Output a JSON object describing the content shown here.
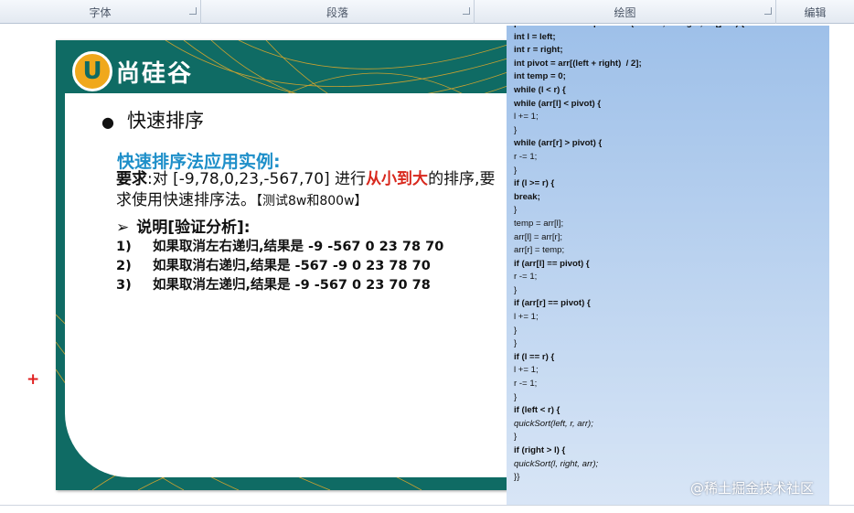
{
  "ribbon": {
    "groups": [
      "字体",
      "段落",
      "绘图",
      "编辑"
    ]
  },
  "slide": {
    "logo_letter": "U",
    "logo_text": "尚硅谷",
    "bullet_dot": "●",
    "title": "快速排序",
    "subheading": "快速排序法应用实例:",
    "req_label": "要求",
    "req_text1": ":对 [-9,78,0,23,-567,70] 进行",
    "req_red": "从小到大",
    "req_text2": "的排序,要求使用快速排序法。",
    "req_note": "【测试8w和800w】",
    "explain_arrow": "➢",
    "explain": "说明[验证分析]:",
    "items": [
      {
        "num": "1)",
        "text": "如果取消左右递归,结果是   -9 -567 0 23 78 70"
      },
      {
        "num": "2)",
        "text": "如果取消右递归,结果是 -567 -9 0 23 78 70"
      },
      {
        "num": "3)",
        "text": "如果取消左递归,结果是 -9 -567 0 23 70 78"
      }
    ]
  },
  "code_lines": [
    {
      "t": "public  static void quickSort(int  left, int right, int[] arr) {",
      "s": "b"
    },
    {
      "t": "int l = left;",
      "s": "b"
    },
    {
      "t": "int r = right;",
      "s": "b"
    },
    {
      "t": "int pivot = arr[(left + right)  / 2];",
      "s": "b"
    },
    {
      "t": "int temp = 0;",
      "s": "b"
    },
    {
      "t": "while (l < r) {",
      "s": "b"
    },
    {
      "t": "while (arr[l] < pivot) {",
      "s": "b"
    },
    {
      "t": "l += 1;",
      "s": ""
    },
    {
      "t": "}",
      "s": ""
    },
    {
      "t": "while (arr[r] > pivot) {",
      "s": "b"
    },
    {
      "t": "r -= 1;",
      "s": ""
    },
    {
      "t": "}",
      "s": ""
    },
    {
      "t": "if (l >= r) {",
      "s": "b"
    },
    {
      "t": "break;",
      "s": "b"
    },
    {
      "t": "}",
      "s": ""
    },
    {
      "t": "temp = arr[l];",
      "s": ""
    },
    {
      "t": "arr[l] = arr[r];",
      "s": ""
    },
    {
      "t": "arr[r] = temp;",
      "s": ""
    },
    {
      "t": "if (arr[l] == pivot) {",
      "s": "b"
    },
    {
      "t": "r -= 1;",
      "s": ""
    },
    {
      "t": "}",
      "s": ""
    },
    {
      "t": "if (arr[r] == pivot) {",
      "s": "b"
    },
    {
      "t": "l += 1;",
      "s": ""
    },
    {
      "t": "}",
      "s": ""
    },
    {
      "t": "}",
      "s": ""
    },
    {
      "t": "if (l == r) {",
      "s": "b"
    },
    {
      "t": "l += 1;",
      "s": ""
    },
    {
      "t": "r -= 1;",
      "s": ""
    },
    {
      "t": "}",
      "s": ""
    },
    {
      "t": "if (left < r) {",
      "s": "b"
    },
    {
      "t": "quickSort(left, r, arr);",
      "s": "i"
    },
    {
      "t": "}",
      "s": ""
    },
    {
      "t": "if (right > l) {",
      "s": "b"
    },
    {
      "t": "quickSort(l, right, arr);",
      "s": "i"
    },
    {
      "t": "}}",
      "s": ""
    }
  ],
  "crosshair": "+",
  "watermark": "@稀土掘金技术社区",
  "colors": {
    "slide_teal": "#0f6b64",
    "accent_blue": "#1e8fc9",
    "accent_red": "#d8281d",
    "logo_orange": "#f0a81c"
  }
}
